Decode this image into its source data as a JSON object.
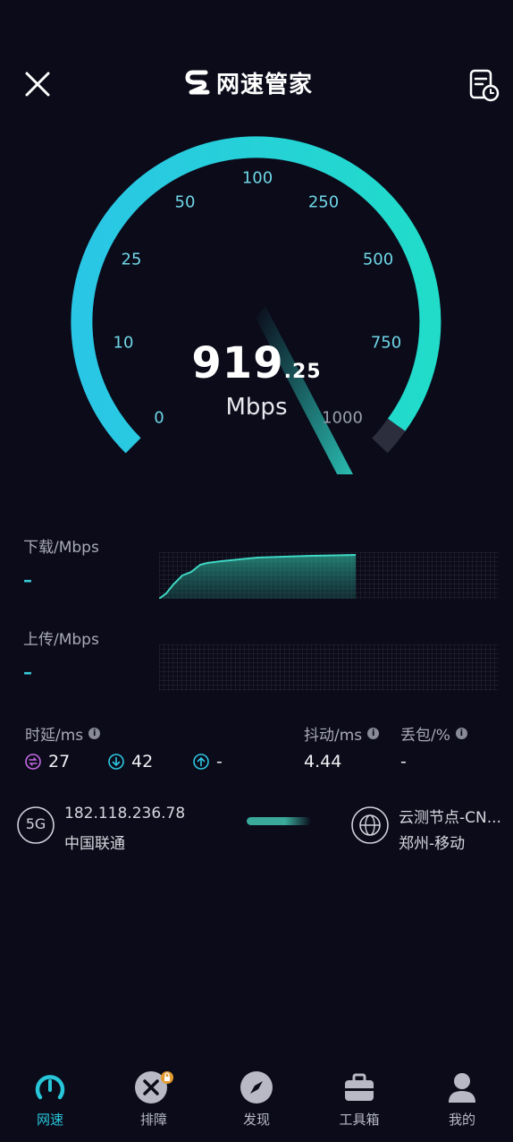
{
  "header": {
    "app_name": "网速管家",
    "close_icon": "close-icon",
    "history_icon": "history-icon"
  },
  "gauge": {
    "ticks": [
      "0",
      "10",
      "25",
      "50",
      "100",
      "250",
      "500",
      "750",
      "1000"
    ],
    "speed_int": "919",
    "speed_dec": ".25",
    "unit": "Mbps",
    "accent": "#2fd8e0"
  },
  "download": {
    "label": "下载/Mbps",
    "value": "–"
  },
  "upload": {
    "label": "上传/Mbps",
    "value": "–"
  },
  "latency": {
    "label": "时延/ms",
    "idle": "27",
    "down": "42",
    "up": "-"
  },
  "jitter": {
    "label": "抖动/ms",
    "value": "4.44"
  },
  "loss": {
    "label": "丢包/%",
    "value": "-"
  },
  "network": {
    "type_badge": "5G",
    "ip": "182.118.236.78",
    "carrier": "中国联通",
    "node": "云测节点-CN...",
    "node_location": "郑州-移动"
  },
  "nav": {
    "items": [
      {
        "label": "网速",
        "icon": "speedometer-icon",
        "active": true
      },
      {
        "label": "排障",
        "icon": "tools-icon",
        "active": false
      },
      {
        "label": "发现",
        "icon": "compass-icon",
        "active": false
      },
      {
        "label": "工具箱",
        "icon": "toolbox-icon",
        "active": false
      },
      {
        "label": "我的",
        "icon": "user-icon",
        "active": false
      }
    ]
  }
}
